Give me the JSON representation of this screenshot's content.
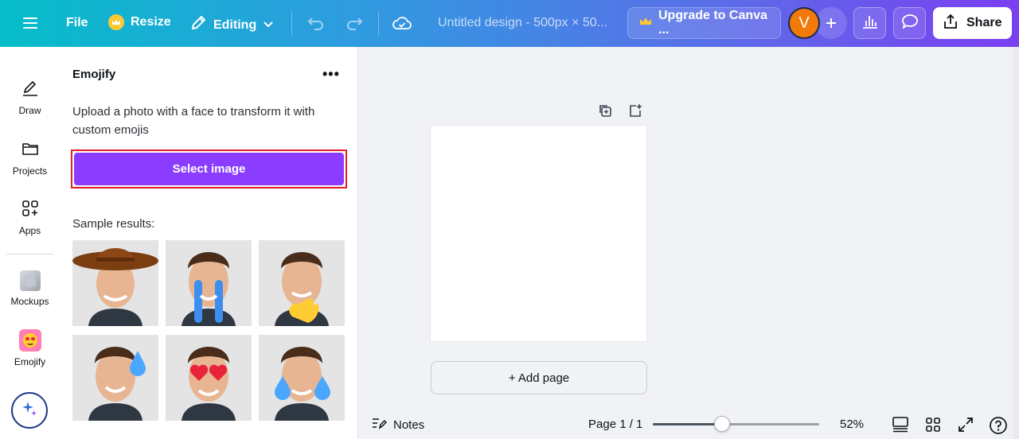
{
  "topbar": {
    "file_label": "File",
    "resize_label": "Resize",
    "editing_label": "Editing",
    "title": "Untitled design - 500px × 50...",
    "upgrade_label": "Upgrade to Canva ...",
    "avatar_initial": "V",
    "share_label": "Share"
  },
  "sidebar": {
    "items": [
      {
        "label": "Draw",
        "icon": "pen-icon"
      },
      {
        "label": "Projects",
        "icon": "folder-icon"
      },
      {
        "label": "Apps",
        "icon": "apps-grid-icon"
      },
      {
        "label": "Mockups",
        "icon": "mockups-icon"
      },
      {
        "label": "Emojify",
        "icon": "emojify-icon"
      }
    ]
  },
  "panel": {
    "title": "Emojify",
    "description": "Upload a photo with a face to transform it with custom emojis",
    "select_label": "Select image",
    "samples_label": "Sample results:",
    "samples": [
      "cowboy-hat",
      "crying-tears",
      "pinch-hand",
      "sweat-drop",
      "heart-eyes",
      "sad-tears"
    ]
  },
  "canvas": {
    "add_page_label": "+ Add page"
  },
  "bottombar": {
    "notes_label": "Notes",
    "page_info": "Page 1 / 1",
    "zoom_label": "52%",
    "zoom_fraction": 0.52
  },
  "colors": {
    "accent": "#8b3dff",
    "highlight_outline": "#e01f2a",
    "avatar": "#f27a0a"
  }
}
